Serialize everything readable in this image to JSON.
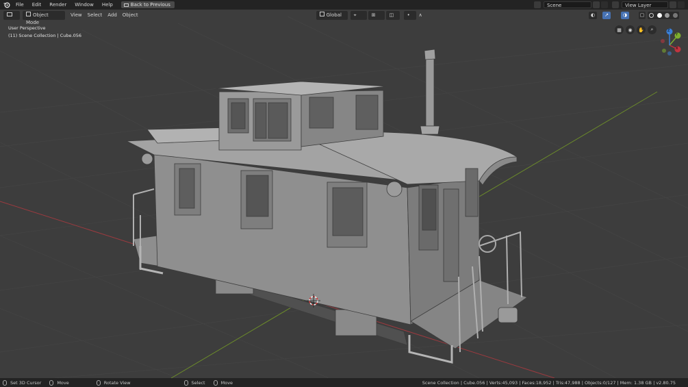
{
  "menu": {
    "items": [
      "File",
      "Edit",
      "Render",
      "Window",
      "Help"
    ],
    "back_label": "Back to Previous"
  },
  "scene": {
    "label": "Scene"
  },
  "view_layer": {
    "label": "View Layer"
  },
  "header": {
    "mode_label": "Object Mode",
    "view_label": "View",
    "select_label": "Select",
    "add_label": "Add",
    "object_label": "Object",
    "orientation_label": "Global"
  },
  "overlay_text": {
    "perspective": "User Perspective",
    "collection": "(11) Scene Collection | Cube.056"
  },
  "gizmo": {
    "x": "X",
    "y": "Y",
    "z": "Z"
  },
  "statusbar": {
    "set_cursor": "Set 3D Cursor",
    "move1": "Move",
    "rotate": "Rotate View",
    "select": "Select",
    "move2": "Move",
    "stats": "Scene Collection | Cube.056 | Verts:45,093 | Faces:18,952 | Tris:47,988 | Objects:0/127 | Mem: 1.38 GB | v2.80.75"
  },
  "colors": {
    "x_axis": "#c0343f",
    "y_axis": "#7fae2f",
    "z_axis": "#3a7fd6",
    "accent": "#4772b3"
  }
}
